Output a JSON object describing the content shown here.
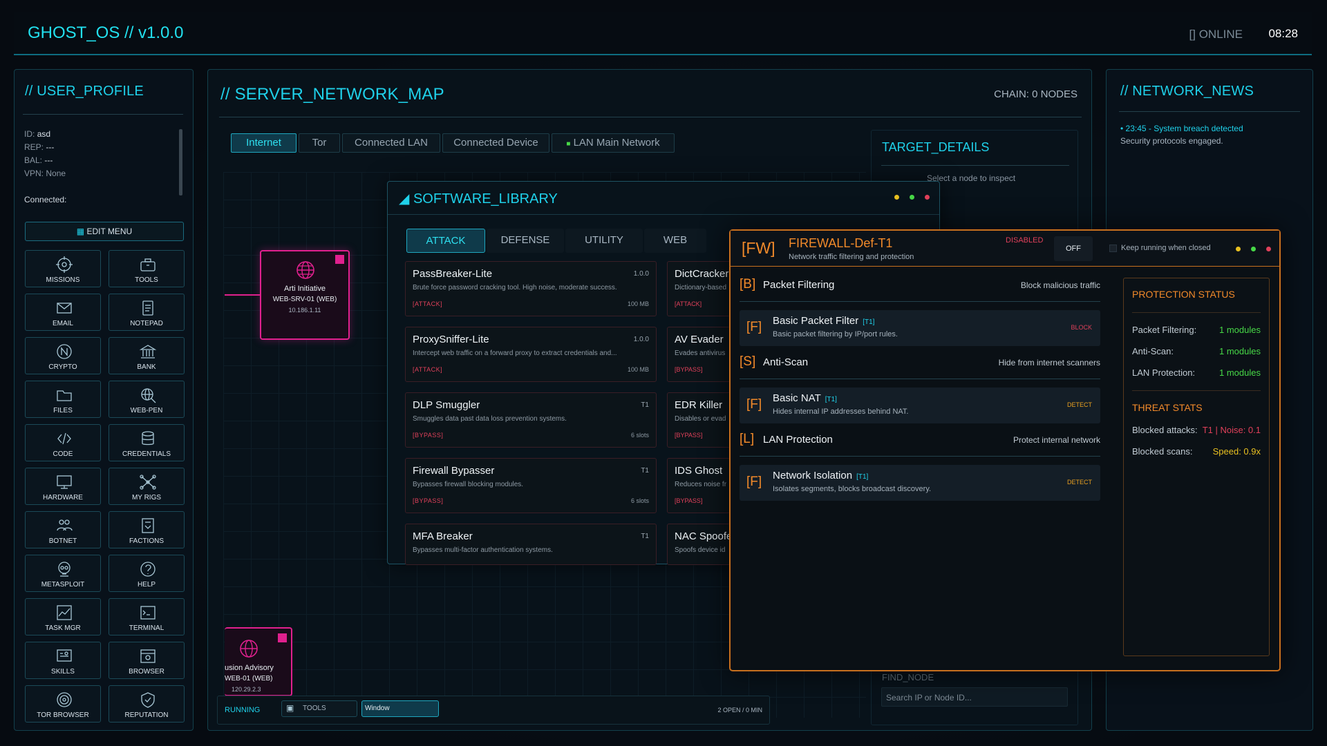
{
  "header": {
    "title": "GHOST_OS // v1.0.0",
    "status": "[] ONLINE",
    "time": "08:28"
  },
  "profile": {
    "title": "// USER_PROFILE",
    "id_label": "ID:",
    "id_value": "asd",
    "rep_label": "REP:",
    "rep_value": "---",
    "bal_label": "BAL:",
    "bal_value": "---",
    "vpn_label": "VPN:",
    "vpn_value": "None",
    "connected_label": "Connected:",
    "edit_menu": "EDIT MENU"
  },
  "apps": [
    {
      "label": "MISSIONS",
      "icon": "target-icon"
    },
    {
      "label": "TOOLS",
      "icon": "toolbox-icon"
    },
    {
      "label": "EMAIL",
      "icon": "envelope-icon"
    },
    {
      "label": "NOTEPAD",
      "icon": "notepad-icon"
    },
    {
      "label": "CRYPTO",
      "icon": "coin-icon"
    },
    {
      "label": "BANK",
      "icon": "bank-icon"
    },
    {
      "label": "FILES",
      "icon": "folder-icon"
    },
    {
      "label": "WEB-PEN",
      "icon": "globe-search-icon"
    },
    {
      "label": "CODE",
      "icon": "code-icon"
    },
    {
      "label": "CREDENTIALS",
      "icon": "database-icon"
    },
    {
      "label": "HARDWARE",
      "icon": "monitor-icon"
    },
    {
      "label": "MY RIGS",
      "icon": "network-icon"
    },
    {
      "label": "BOTNET",
      "icon": "users-icon"
    },
    {
      "label": "FACTIONS",
      "icon": "faction-icon"
    },
    {
      "label": "METASPLOIT",
      "icon": "skull-icon"
    },
    {
      "label": "HELP",
      "icon": "help-icon"
    },
    {
      "label": "TASK MGR",
      "icon": "chart-icon"
    },
    {
      "label": "TERMINAL",
      "icon": "terminal-icon"
    },
    {
      "label": "SKILLS",
      "icon": "skills-icon"
    },
    {
      "label": "BROWSER",
      "icon": "browser-icon"
    },
    {
      "label": "TOR BROWSER",
      "icon": "onion-icon"
    },
    {
      "label": "REPUTATION",
      "icon": "shield-icon"
    }
  ],
  "network_map": {
    "title": "// SERVER_NETWORK_MAP",
    "chain": "CHAIN: 0 NODES",
    "tabs": [
      "Internet",
      "Tor",
      "Connected LAN",
      "Connected Device",
      "LAN Main Network"
    ],
    "node1": {
      "name": "Arti Initiative",
      "host": "WEB-SRV-01 (WEB)",
      "ip": "10.186.1.11"
    },
    "node2": {
      "name": "usion Advisory",
      "host": "WEB-01 (WEB)",
      "ip": "120.29.2.3"
    }
  },
  "target": {
    "title": "TARGET_DETAILS",
    "hint": "Select a node to inspect",
    "find": "FIND_NODE",
    "search_placeholder": "Search IP or Node ID..."
  },
  "news": {
    "title": "// NETWORK_NEWS",
    "headline": "• 23:45 - System breach detected",
    "body": "Security protocols engaged."
  },
  "library": {
    "title": "SOFTWARE_LIBRARY",
    "tabs": [
      "ATTACK",
      "DEFENSE",
      "UTILITY",
      "WEB"
    ],
    "cards": [
      {
        "name": "PassBreaker-Lite",
        "ver": "1.0.0",
        "desc": "Brute force password cracking tool. High noise, moderate success.",
        "tag": "[ATTACK]",
        "size": "100 MB"
      },
      {
        "name": "ProxySniffer-Lite",
        "ver": "1.0.0",
        "desc": "Intercept web traffic on a forward proxy to extract credentials and...",
        "tag": "[ATTACK]",
        "size": "100 MB"
      },
      {
        "name": "DLP Smuggler",
        "ver": "T1",
        "desc": "Smuggles data past data loss prevention systems.",
        "tag": "[BYPASS]",
        "size": "6 slots"
      },
      {
        "name": "Firewall Bypasser",
        "ver": "T1",
        "desc": "Bypasses firewall blocking modules.",
        "tag": "[BYPASS]",
        "size": "6 slots"
      },
      {
        "name": "MFA Breaker",
        "ver": "T1",
        "desc": "Bypasses multi-factor authentication systems.",
        "tag": "",
        "size": ""
      }
    ],
    "cards_right": [
      {
        "name": "DictCracker",
        "desc": "Dictionary-based",
        "tag": "[ATTACK]"
      },
      {
        "name": "AV Evader",
        "desc": "Evades antivirus",
        "tag": "[BYPASS]"
      },
      {
        "name": "EDR Killer",
        "desc": "Disables or evad",
        "tag": "[BYPASS]"
      },
      {
        "name": "IDS Ghost",
        "desc": "Reduces noise fr",
        "tag": "[BYPASS]"
      },
      {
        "name": "NAC Spoofe",
        "desc": "Spoofs device id",
        "tag": ""
      }
    ]
  },
  "firewall": {
    "badge": "[FW]",
    "name": "FIREWALL-Def-T1",
    "subtitle": "Network traffic filtering and protection",
    "state": "DISABLED",
    "toggle": "OFF",
    "keep": "Keep running when closed",
    "sections": [
      {
        "key": "[B]",
        "label": "Packet Filtering",
        "right": "Block malicious traffic",
        "module": {
          "key": "[F]",
          "name": "Basic Packet Filter",
          "tier": "[T1]",
          "desc": "Basic packet filtering by IP/port rules.",
          "action": "BLOCK"
        }
      },
      {
        "key": "[S]",
        "label": "Anti-Scan",
        "right": "Hide from internet scanners",
        "module": {
          "key": "[F]",
          "name": "Basic NAT",
          "tier": "[T1]",
          "desc": "Hides internal IP addresses behind NAT.",
          "action": "DETECT"
        }
      },
      {
        "key": "[L]",
        "label": "LAN Protection",
        "right": "Protect internal network",
        "module": {
          "key": "[F]",
          "name": "Network Isolation",
          "tier": "[T1]",
          "desc": "Isolates segments, blocks broadcast discovery.",
          "action": "DETECT"
        }
      }
    ],
    "protection": {
      "title": "PROTECTION STATUS",
      "rows": [
        {
          "label": "Packet Filtering:",
          "value": "1 modules"
        },
        {
          "label": "Anti-Scan:",
          "value": "1 modules"
        },
        {
          "label": "LAN Protection:",
          "value": "1 modules"
        }
      ],
      "threat_title": "THREAT STATS",
      "blocked_attacks_label": "Blocked attacks:",
      "blocked_attacks_value": "T1 | Noise: 0.1",
      "blocked_scans_label": "Blocked scans:",
      "blocked_scans_value": "Speed: 0.9x"
    }
  },
  "taskbar": {
    "running": "RUNNING",
    "tools": "TOOLS",
    "window": "Window",
    "info": "2 OPEN / 0 MIN"
  },
  "colors": {
    "accent": "#1fd1ea",
    "orange": "#f28a2a",
    "red": "#e0405a",
    "green": "#47d847",
    "pink": "#e0208e"
  }
}
